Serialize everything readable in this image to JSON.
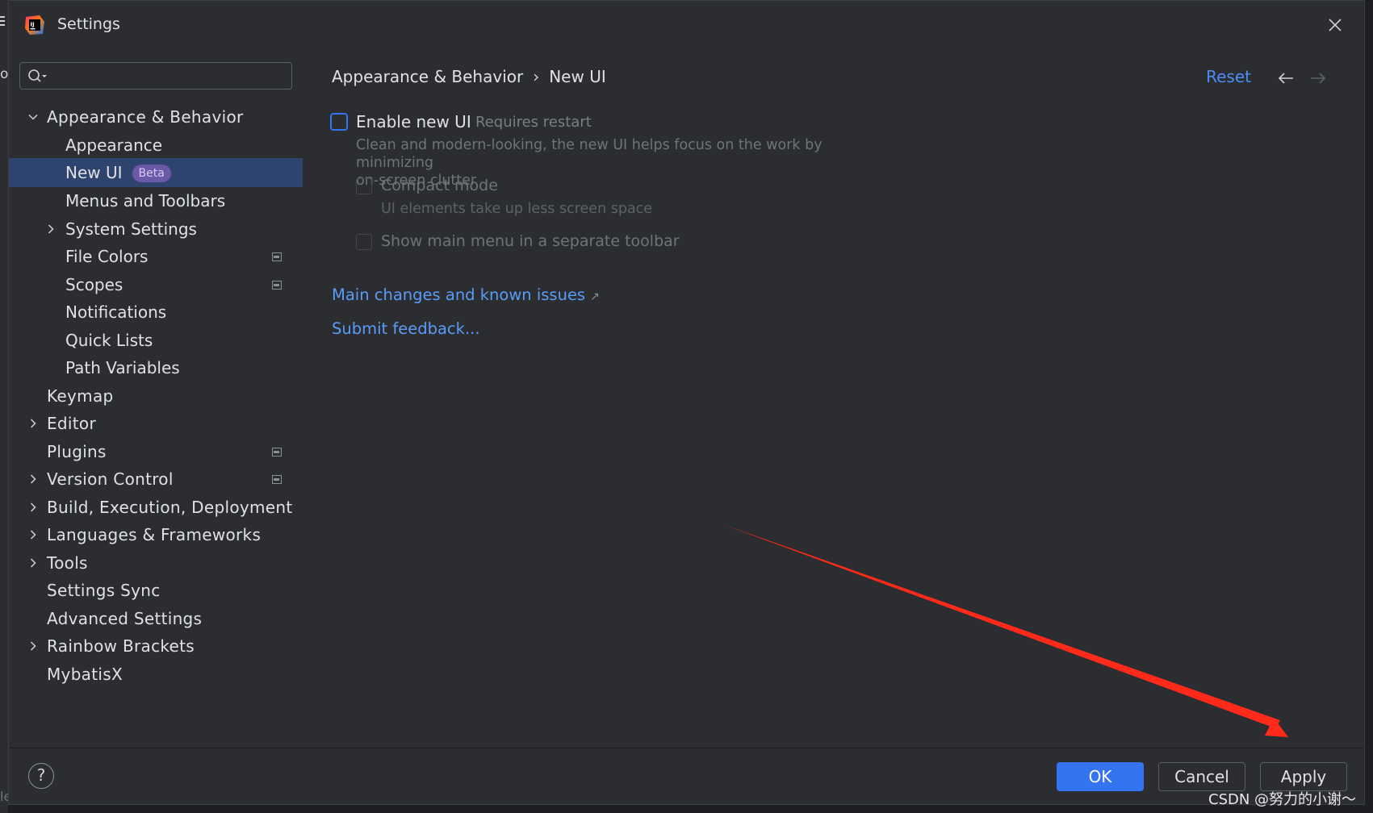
{
  "window": {
    "title": "Settings"
  },
  "background_left": {
    "glyph_o": "o",
    "glyph_l": "le"
  },
  "sidebar": {
    "search": {
      "placeholder": "",
      "value": ""
    },
    "items": [
      {
        "label": "Appearance & Behavior",
        "level": 0,
        "chevron": "expanded"
      },
      {
        "label": "Appearance",
        "level": 1
      },
      {
        "label": "New UI",
        "level": 1,
        "selected": true,
        "badge": "Beta"
      },
      {
        "label": "Menus and Toolbars",
        "level": 1
      },
      {
        "label": "System Settings",
        "level": 1,
        "chevron": "collapsed"
      },
      {
        "label": "File Colors",
        "level": 1,
        "project_icon": true
      },
      {
        "label": "Scopes",
        "level": 1,
        "project_icon": true
      },
      {
        "label": "Notifications",
        "level": 1
      },
      {
        "label": "Quick Lists",
        "level": 1
      },
      {
        "label": "Path Variables",
        "level": 1
      },
      {
        "label": "Keymap",
        "level": 0
      },
      {
        "label": "Editor",
        "level": 0,
        "chevron": "collapsed"
      },
      {
        "label": "Plugins",
        "level": 0,
        "project_icon": true
      },
      {
        "label": "Version Control",
        "level": 0,
        "chevron": "collapsed",
        "project_icon": true
      },
      {
        "label": "Build, Execution, Deployment",
        "level": 0,
        "chevron": "collapsed"
      },
      {
        "label": "Languages & Frameworks",
        "level": 0,
        "chevron": "collapsed"
      },
      {
        "label": "Tools",
        "level": 0,
        "chevron": "collapsed"
      },
      {
        "label": "Settings Sync",
        "level": 0
      },
      {
        "label": "Advanced Settings",
        "level": 0
      },
      {
        "label": "Rainbow Brackets",
        "level": 0,
        "chevron": "collapsed"
      },
      {
        "label": "MybatisX",
        "level": 0
      }
    ]
  },
  "main": {
    "breadcrumb": {
      "parent": "Appearance & Behavior",
      "separator": "›",
      "current": "New UI"
    },
    "reset_label": "Reset",
    "enable_new_ui": {
      "label": "Enable new UI",
      "checked": false,
      "hint": "Requires restart",
      "description_line1": "Clean and modern-looking, the new UI helps focus on the work by minimizing",
      "description_line2": "on-screen clutter"
    },
    "compact_mode": {
      "label": "Compact mode",
      "checked": false,
      "enabled": false,
      "hint": "UI elements take up less screen space"
    },
    "separate_toolbar": {
      "label": "Show main menu in a separate toolbar",
      "checked": false,
      "enabled": false
    },
    "links": {
      "changes": "Main changes and known issues",
      "changes_ext": "↗",
      "feedback": "Submit feedback..."
    }
  },
  "footer": {
    "help": "?",
    "ok_label": "OK",
    "cancel_label": "Cancel",
    "apply_label": "Apply"
  },
  "watermark": "CSDN @努力的小谢～",
  "colors": {
    "accent": "#3574f0",
    "link": "#5a9cf8",
    "selection": "#2e436e",
    "beta_badge": "#6b58a8",
    "annotation_arrow": "#ff2a1a"
  }
}
